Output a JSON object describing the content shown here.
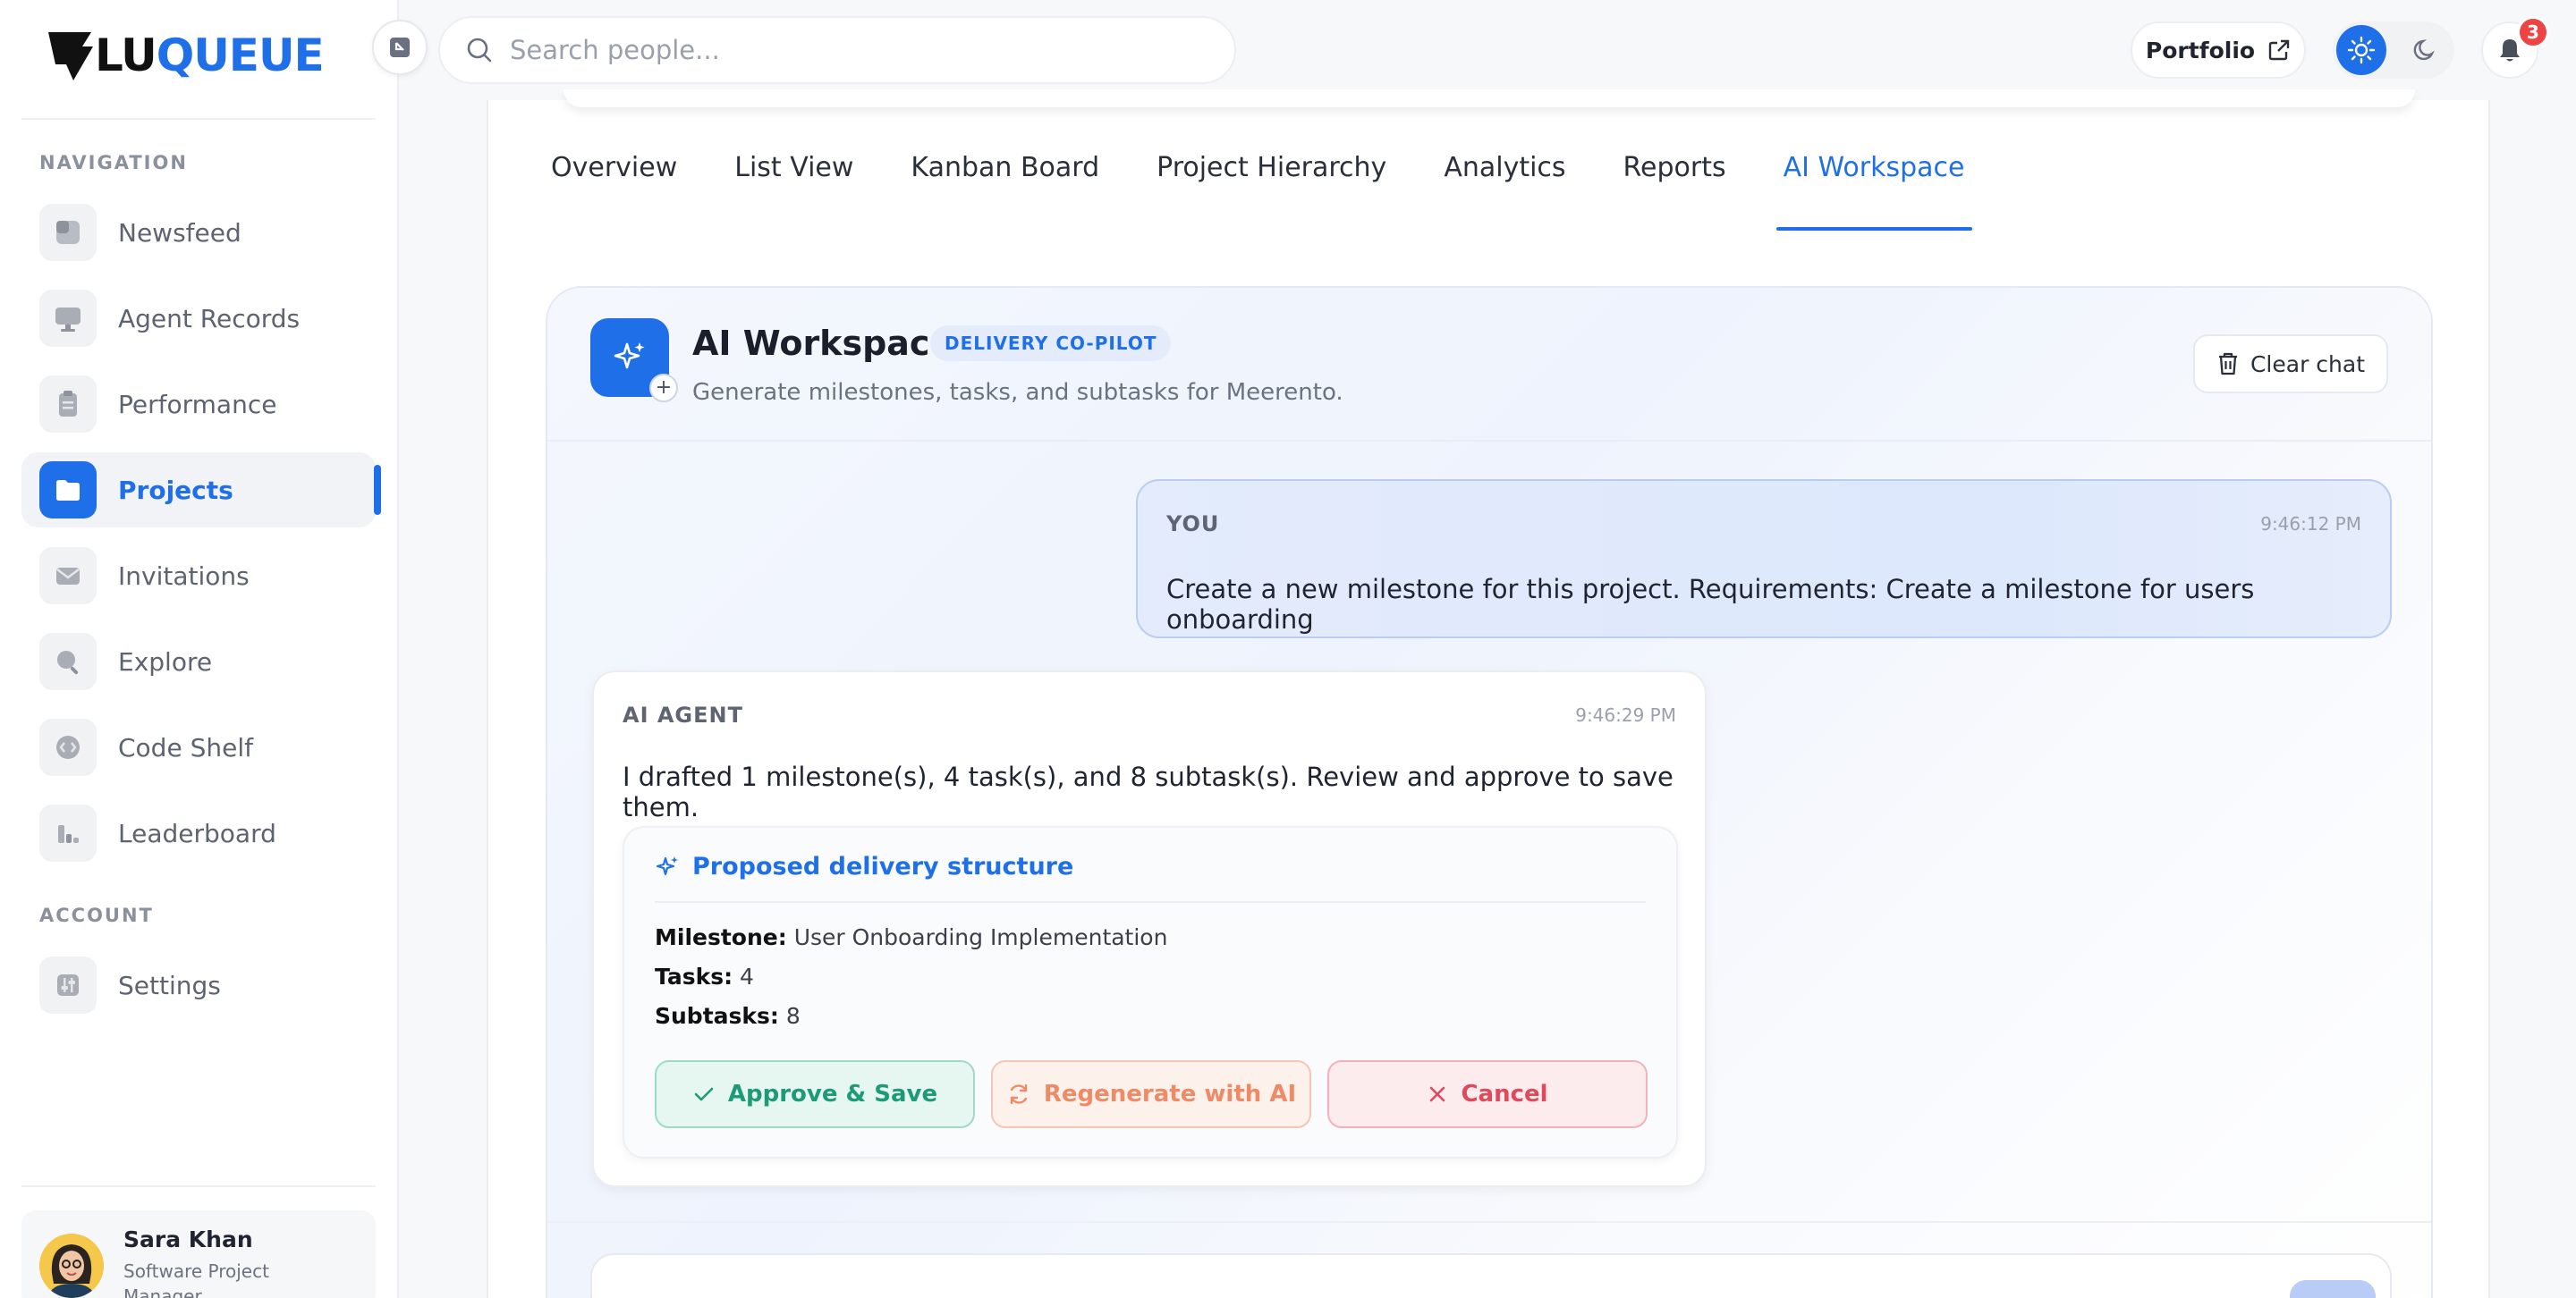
{
  "brand": {
    "prefix": "LU",
    "suffix": "QUEUE",
    "accent": "#1f6fe8"
  },
  "sidebar": {
    "navigation_label": "NAVIGATION",
    "account_label": "ACCOUNT",
    "items": [
      {
        "label": "Newsfeed",
        "icon": "newsfeed-icon"
      },
      {
        "label": "Agent Records",
        "icon": "monitor-icon"
      },
      {
        "label": "Performance",
        "icon": "clipboard-icon"
      },
      {
        "label": "Projects",
        "icon": "folder-icon",
        "active": true
      },
      {
        "label": "Invitations",
        "icon": "mail-icon"
      },
      {
        "label": "Explore",
        "icon": "search-icon"
      },
      {
        "label": "Code Shelf",
        "icon": "code-icon"
      },
      {
        "label": "Leaderboard",
        "icon": "bar-chart-icon"
      }
    ],
    "account_items": [
      {
        "label": "Settings",
        "icon": "sliders-icon"
      }
    ],
    "user": {
      "name": "Sara Khan",
      "role": "Software Project Manager"
    }
  },
  "topbar": {
    "search_placeholder": "Search people...",
    "portfolio_label": "Portfolio",
    "notification_count": "3"
  },
  "tabs": [
    {
      "label": "Overview"
    },
    {
      "label": "List View"
    },
    {
      "label": "Kanban Board"
    },
    {
      "label": "Project Hierarchy"
    },
    {
      "label": "Analytics"
    },
    {
      "label": "Reports"
    },
    {
      "label": "AI Workspace",
      "active": true
    }
  ],
  "workspace": {
    "title": "AI Workspace",
    "badge": "DELIVERY CO-PILOT",
    "subtitle": "Generate milestones, tasks, and subtasks for Meerento.",
    "clear_label": "Clear chat",
    "messages": {
      "user": {
        "role": "YOU",
        "time": "9:46:12 PM",
        "text": "Create a new milestone for this project. Requirements: Create a milestone for users onboarding"
      },
      "ai": {
        "role": "AI AGENT",
        "time": "9:46:29 PM",
        "text": "I drafted 1 milestone(s), 4 task(s), and 8 subtask(s). Review and approve to save them."
      }
    },
    "proposal": {
      "title": "Proposed delivery structure",
      "milestone_key": "Milestone:",
      "milestone_value": "User Onboarding Implementation",
      "tasks_key": "Tasks:",
      "tasks_value": "4",
      "subtasks_key": "Subtasks:",
      "subtasks_value": "8",
      "approve_label": "Approve & Save",
      "regenerate_label": "Regenerate with AI",
      "cancel_label": "Cancel"
    },
    "compose_placeholder": ""
  }
}
